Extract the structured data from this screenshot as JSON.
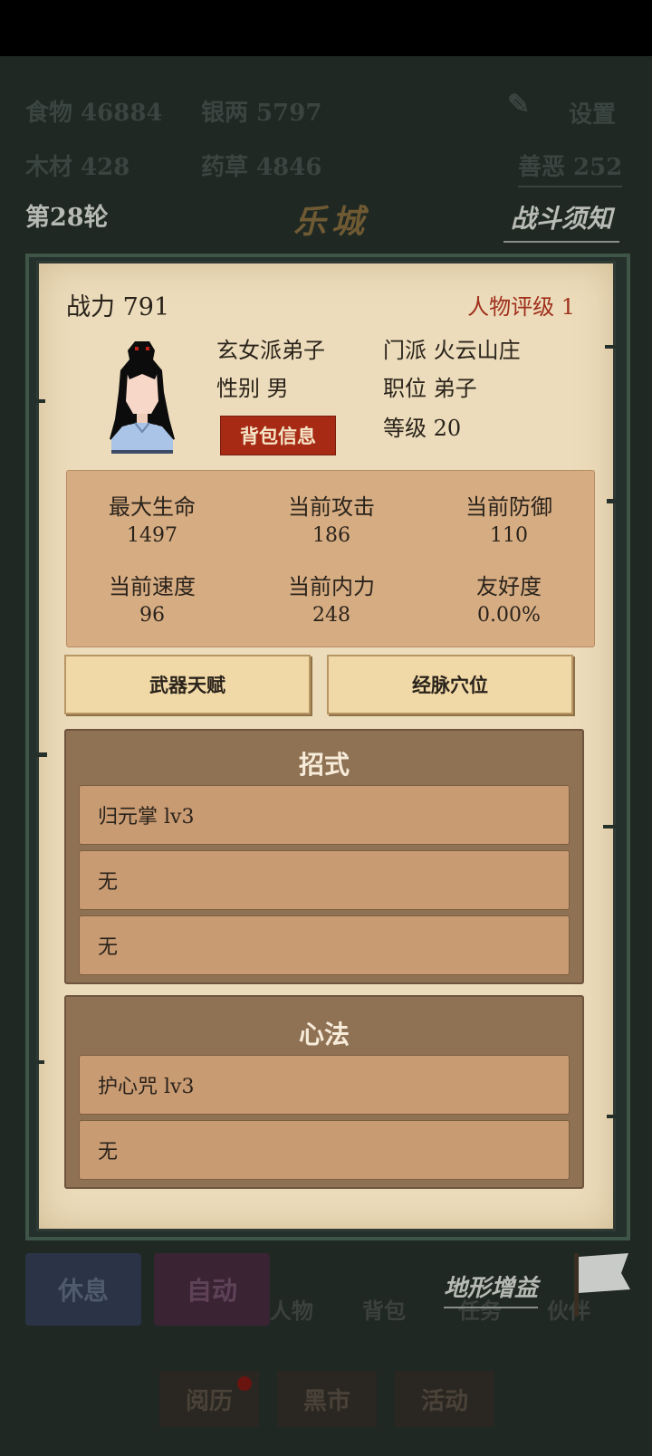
{
  "resources": {
    "food": "食物 46884",
    "silver": "银两 5797",
    "wood": "木材 428",
    "herbs": "药草 4846",
    "settings": "设置",
    "karma": "善恶 252"
  },
  "header": {
    "round": "第28轮",
    "city": "乐城",
    "battle_tips": "战斗须知"
  },
  "character": {
    "power": "战力 791",
    "rating": "人物评级 1",
    "title": "玄女派弟子",
    "sect": "门派 火云山庄",
    "gender": "性别 男",
    "position": "职位 弟子",
    "bag_button": "背包信息",
    "level": "等级 20"
  },
  "stats": [
    {
      "label": "最大生命",
      "value": "1497"
    },
    {
      "label": "当前攻击",
      "value": "186"
    },
    {
      "label": "当前防御",
      "value": "110"
    },
    {
      "label": "当前速度",
      "value": "96"
    },
    {
      "label": "当前内力",
      "value": "248"
    },
    {
      "label": "友好度",
      "value": "0.00%"
    }
  ],
  "tabs": {
    "weapon_talent": "武器天赋",
    "meridians": "经脉穴位"
  },
  "moves": {
    "title": "招式",
    "slots": [
      "归元掌  lv3",
      "无",
      "无"
    ]
  },
  "mind": {
    "title": "心法",
    "slots": [
      "护心咒  lv3",
      "无"
    ]
  },
  "bottom": {
    "rest": "休息",
    "auto": "自动",
    "character": "人物",
    "bag": "背包",
    "task": "任务",
    "partner": "伙伴",
    "terrain_bonus": "地形增益",
    "experience": "阅历",
    "black_market": "黑市",
    "events": "活动"
  },
  "colors": {
    "parchment": "#ecdcbb",
    "stats_panel": "#d6ac82",
    "section_bg": "#8f7154",
    "slot_bg": "#c99b73",
    "accent_red": "#a62a14"
  }
}
